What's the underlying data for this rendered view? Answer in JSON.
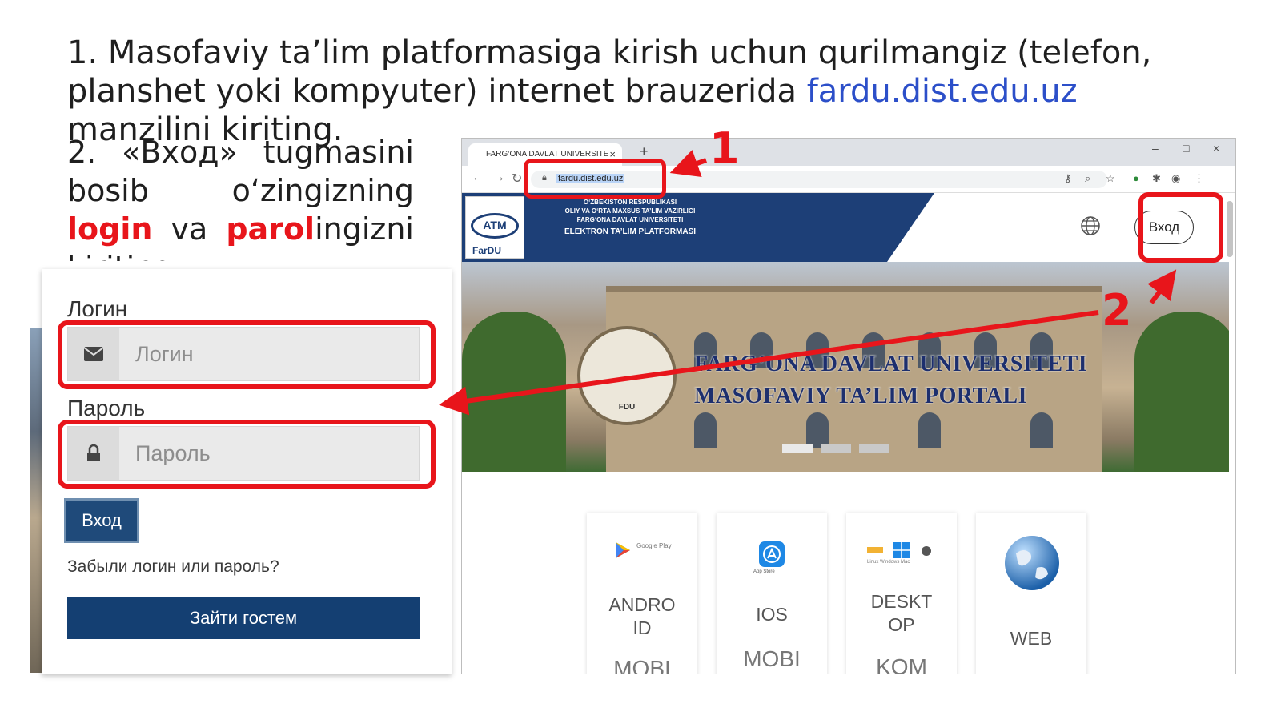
{
  "step1": {
    "before": "1. Masofaviy ta’lim platformasiga kirish uchun qurilmangiz (telefon, planshet yoki kompyuter) internet brauzerida ",
    "link": "fardu.dist.edu.uz",
    "after": " manzilini kiriting."
  },
  "step2": {
    "part1": "2. «Вход» tugmasini bosib o‘zingizning ",
    "login": "login",
    "va": " va ",
    "parol": "parol",
    "part2": "ingizni kiriting."
  },
  "login_form": {
    "login_label": "Логин",
    "login_placeholder": "Логин",
    "password_label": "Пароль",
    "password_placeholder": "Пароль",
    "submit": "Вход",
    "forgot": "Забыли логин или пароль?",
    "guest": "Зайти гостем"
  },
  "browser": {
    "tab_title": "FARG‘ONA DAVLAT UNIVERSITE",
    "tab_close": "×",
    "new_tab": "+",
    "url": "fardu.dist.edu.uz",
    "win_min": "–",
    "win_max": "□",
    "win_close": "×"
  },
  "site": {
    "logo_text": "ATM",
    "logo_sub": "FarDU",
    "header_lines": [
      "O‘ZBEKISTON RESPUBLIKASI",
      "OLIY VA O‘RTA MAXSUS TA’LIM VAZIRLIGI",
      "FARG‘ONA DAVLAT UNIVERSITETI"
    ],
    "header_main": "ELEKTRON TA’LIM PLATFORMASI",
    "login_button": "Вход",
    "hero_line1": "FARG‘ONA DAVLAT UNIVERSITETI",
    "hero_line2": "MASOFAVIY TA’LIM PORTALI",
    "seal_text": "FDU",
    "cards": [
      {
        "title": "ANDRO ID",
        "sub": "MOBI",
        "badge": "Google Play"
      },
      {
        "title": "IOS",
        "sub": "MOBI",
        "badge": "App Store"
      },
      {
        "title": "DESKT OP",
        "sub": "KOM",
        "badge": "Linux Windows Mac"
      },
      {
        "title": "WEB",
        "sub": "",
        "badge": ""
      }
    ]
  },
  "annotations": {
    "num1": "1",
    "num2": "2"
  },
  "colors": {
    "accent_red": "#e8151b",
    "link_blue": "#2c4fc9",
    "site_navy": "#1d3f77"
  }
}
